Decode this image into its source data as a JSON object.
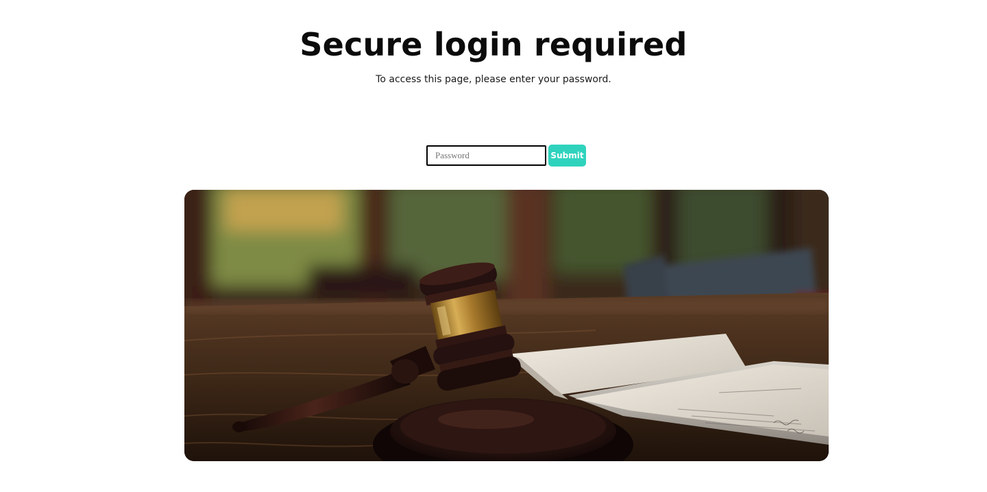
{
  "page": {
    "title": "Secure login required",
    "subtitle": "To access this page, please enter your password."
  },
  "form": {
    "password_placeholder": "Password",
    "password_value": "",
    "submit_label": "Submit"
  },
  "colors": {
    "accent": "#2fd3bd",
    "text": "#0b0b0b",
    "background": "#ffffff"
  },
  "hero_image": {
    "icon": "gavel-on-courtroom-table-photo"
  }
}
